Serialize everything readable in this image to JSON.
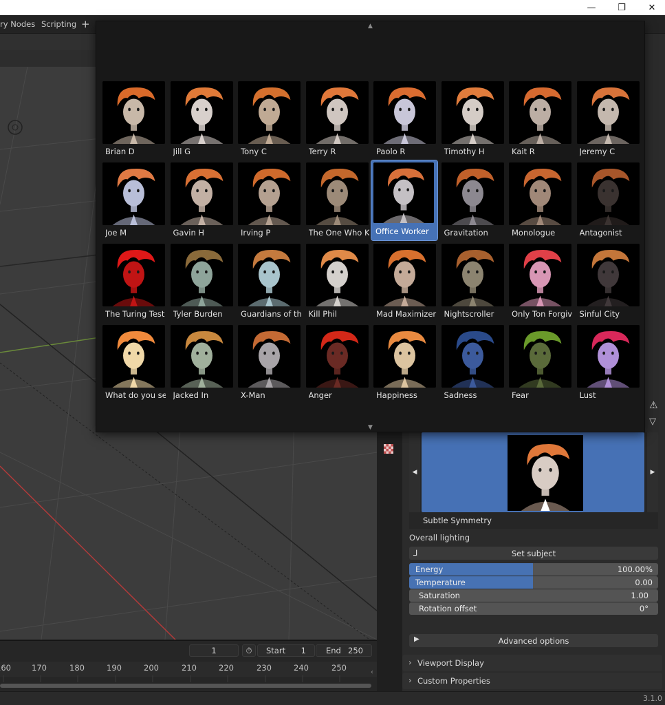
{
  "window": {
    "minimize": "—",
    "restore": "❐",
    "close": "✕"
  },
  "workspaces": {
    "tabs": [
      "ry Nodes",
      "Scripting"
    ],
    "add": "+"
  },
  "timeline": {
    "current_frame": "1",
    "start_label": "Start",
    "start_value": "1",
    "end_label": "End",
    "end_value": "250",
    "ruler": [
      "160",
      "170",
      "180",
      "190",
      "200",
      "210",
      "220",
      "230",
      "240",
      "250"
    ]
  },
  "popup": {
    "presets": [
      {
        "name": "Brian D",
        "hair": "#d96a2a",
        "light": "#c8b8a8"
      },
      {
        "name": "Jill G",
        "hair": "#e07a38",
        "light": "#d8d0cc"
      },
      {
        "name": "Tony C",
        "hair": "#d4702e",
        "light": "#c0aa94"
      },
      {
        "name": "Terry R",
        "hair": "#e0783a",
        "light": "#cfc6c0"
      },
      {
        "name": "Paolo R",
        "hair": "#da6c30",
        "light": "#c8c6d8"
      },
      {
        "name": "Timothy H",
        "hair": "#e07c3c",
        "light": "#d4ccc6"
      },
      {
        "name": "Kait R",
        "hair": "#d66a30",
        "light": "#bcaea4"
      },
      {
        "name": "Jeremy C",
        "hair": "#d8733a",
        "light": "#c4b8ae"
      },
      {
        "name": "Joe M",
        "hair": "#e07a44",
        "light": "#b8bed8"
      },
      {
        "name": "Gavin H",
        "hair": "#d87034",
        "light": "#c2b0a4"
      },
      {
        "name": "Irving P",
        "hair": "#cf6a2c",
        "light": "#b4a090"
      },
      {
        "name": "The One Who K...",
        "hair": "#c4682c",
        "light": "#9c8a78"
      },
      {
        "name": "Office Worker",
        "hair": "#d8703a",
        "light": "#c4c0c4"
      },
      {
        "name": "Gravitation",
        "hair": "#c0602a",
        "light": "#8c8890"
      },
      {
        "name": "Monologue",
        "hair": "#c86630",
        "light": "#a08878"
      },
      {
        "name": "Antagonist",
        "hair": "#a8562a",
        "light": "#3a3230"
      },
      {
        "name": "The Turing Test",
        "hair": "#e01818",
        "light": "#c01414"
      },
      {
        "name": "Tyler Burden",
        "hair": "#8a6a3a",
        "light": "#8ea49a"
      },
      {
        "name": "Guardians of th...",
        "hair": "#c47a3e",
        "light": "#a8c4cc"
      },
      {
        "name": "Kill Phil",
        "hair": "#e08a48",
        "light": "#d4d0cc"
      },
      {
        "name": "Mad Maximizer",
        "hair": "#d8702e",
        "light": "#c4aa98"
      },
      {
        "name": "Nightscroller",
        "hair": "#a8602e",
        "light": "#8c8470"
      },
      {
        "name": "Only Ton Forgiv...",
        "hair": "#e04048",
        "light": "#d896b4"
      },
      {
        "name": "Sinful City",
        "hair": "#c4763a",
        "light": "#40383a"
      },
      {
        "name": "What do you see",
        "hair": "#f08a3c",
        "light": "#f0d8a8"
      },
      {
        "name": "Jacked In",
        "hair": "#c8883e",
        "light": "#a0b09c"
      },
      {
        "name": "X-Man",
        "hair": "#c46a34",
        "light": "#a8a4a8"
      },
      {
        "name": "Anger",
        "hair": "#d42818",
        "light": "#6a2a24"
      },
      {
        "name": "Happiness",
        "hair": "#e88a40",
        "light": "#dcc4a0"
      },
      {
        "name": "Sadness",
        "hair": "#2a4a8a",
        "light": "#3c5a9c"
      },
      {
        "name": "Fear",
        "hair": "#6a9a2a",
        "light": "#5a6a3a"
      },
      {
        "name": "Lust",
        "hair": "#d8285a",
        "light": "#b090d8"
      }
    ],
    "selected_index": 12
  },
  "properties": {
    "preview_name": "Subtle Symmetry",
    "overall_lighting": "Overall lighting",
    "set_subject": "Set subject",
    "energy_label": "Energy",
    "energy_value": "100.00%",
    "energy_fraction": 0.45,
    "temperature_label": "Temperature",
    "temperature_value": "0.00",
    "temperature_fraction": 0.45,
    "saturation_label": "Saturation",
    "saturation_value": "1.00",
    "rotation_label": "Rotation offset",
    "rotation_value": "0°",
    "advanced_options": "Advanced options",
    "viewport_display": "Viewport Display",
    "custom_properties": "Custom Properties"
  },
  "status": {
    "version": "3.1.0"
  },
  "colors": {
    "accent": "#4772b3",
    "popup_bg": "#181818"
  }
}
